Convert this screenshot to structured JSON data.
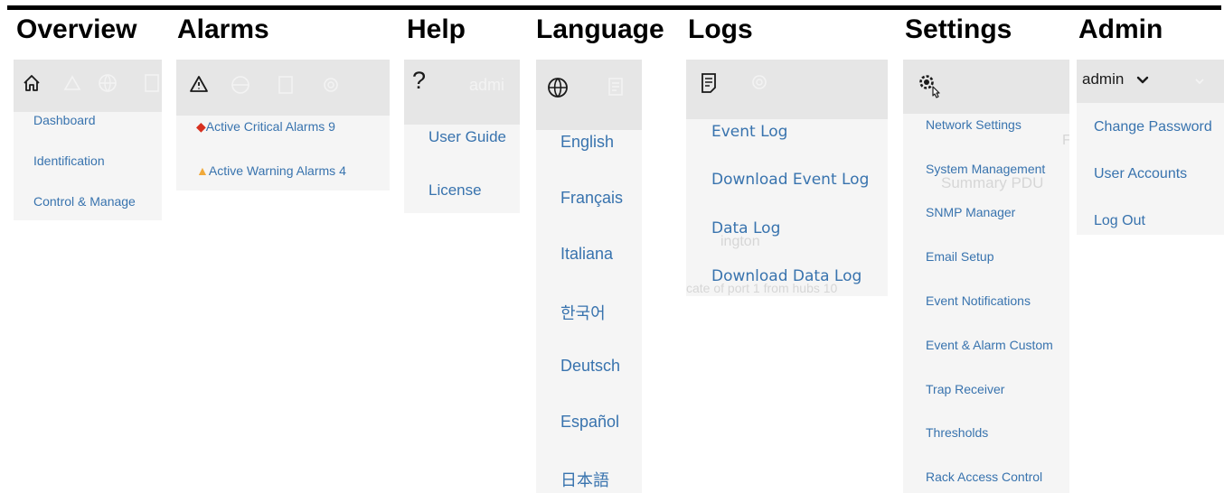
{
  "headings": {
    "overview": "Overview",
    "alarms": "Alarms",
    "help": "Help",
    "language": "Language",
    "logs": "Logs",
    "settings": "Settings",
    "admin": "Admin"
  },
  "overview_menu": {
    "icon": "home-icon",
    "items": [
      "Dashboard",
      "Identification",
      "Control & Manage"
    ]
  },
  "alarms_menu": {
    "icon": "warning-triangle-icon",
    "critical": {
      "label": "Active Critical Alarms",
      "count": "9",
      "color": "#d7301f"
    },
    "warning": {
      "label": "Active Warning Alarms",
      "count": "4",
      "color": "#f0a93a"
    }
  },
  "help_menu": {
    "icon": "question-icon",
    "ghost_user": "admi",
    "items": [
      "User Guide",
      "License"
    ]
  },
  "language_menu": {
    "icon": "globe-icon",
    "items": [
      "English",
      "Français",
      "Italiana",
      "한국어",
      "Deutsch",
      "Español",
      "日本語"
    ]
  },
  "logs_menu": {
    "icon": "document-icon",
    "items": [
      "Event Log",
      "Download Event Log",
      "Data Log",
      "Download Data Log"
    ],
    "ghost_texts": [
      "ington",
      "cate of port 1 from hubs 10"
    ]
  },
  "settings_menu": {
    "icon": "settings-gear-icon",
    "items": [
      "Network Settings",
      "System Management",
      "SNMP Manager",
      "Email Setup",
      "Event Notifications",
      "Event & Alarm Custom",
      "Trap Receiver",
      "Thresholds",
      "Rack Access Control"
    ],
    "ghost_texts": [
      "Summary   PDU",
      "F"
    ]
  },
  "admin_menu": {
    "username": "admin",
    "items": [
      "Change Password",
      "User Accounts",
      "Log Out"
    ]
  },
  "colors": {
    "link": "#3873ae",
    "panel_bg": "#f5f5f5",
    "header_bar": "#e6e6e6"
  }
}
